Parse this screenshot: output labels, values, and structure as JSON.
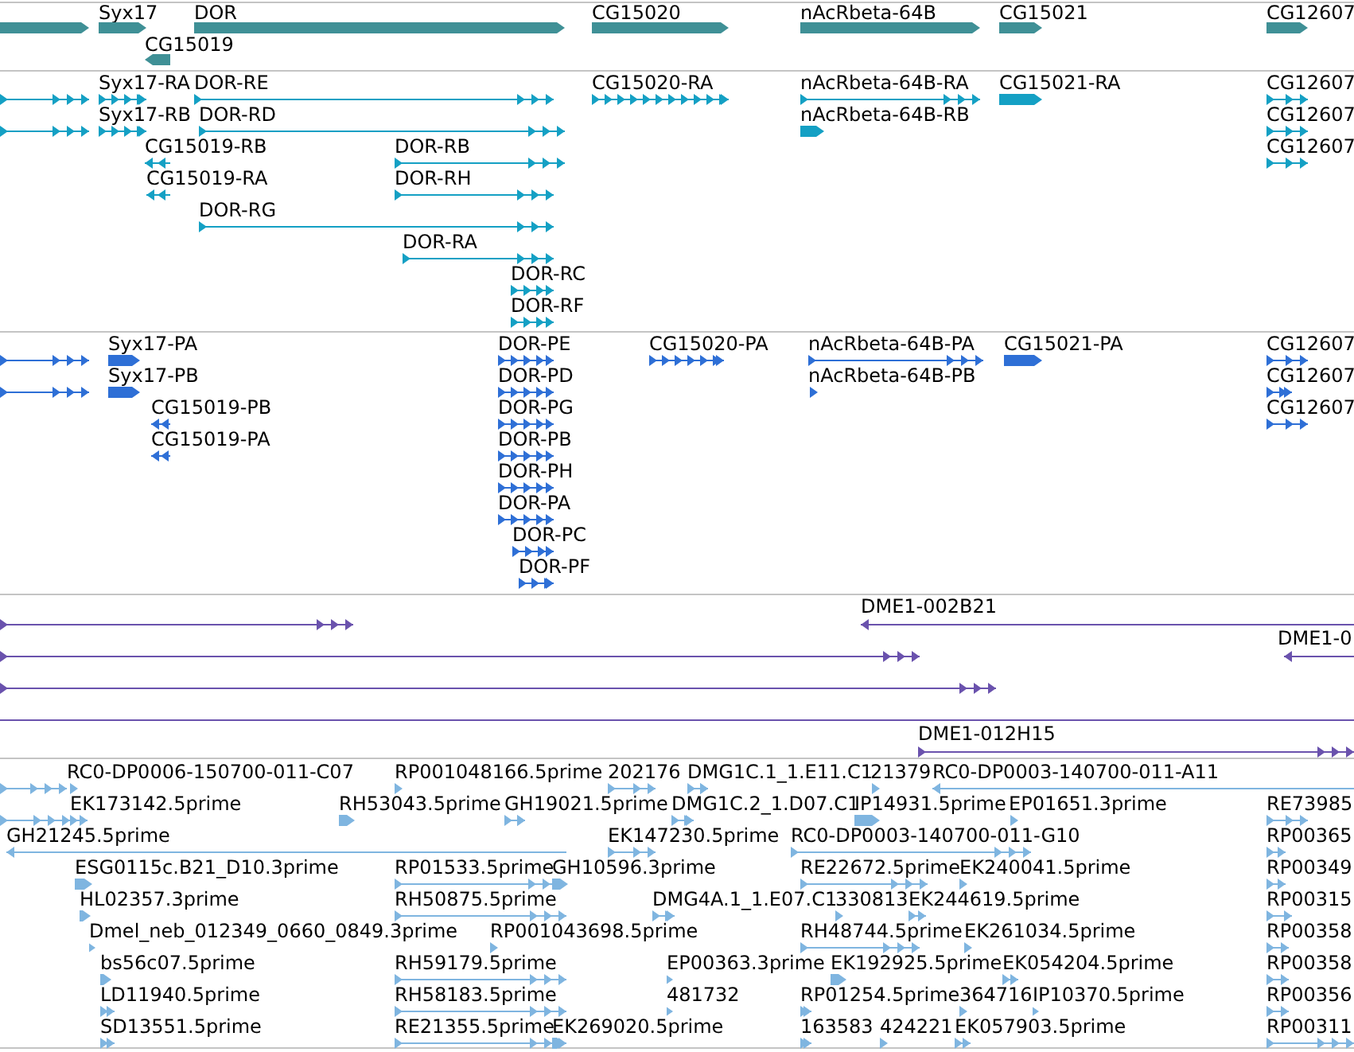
{
  "tracks": [
    {
      "kind": "gene",
      "features": [
        {
          "label": "Syx17"
        },
        {
          "label": "DOR"
        },
        {
          "label": "CG15020"
        },
        {
          "label": "nAcRbeta-64B"
        },
        {
          "label": "CG15021"
        },
        {
          "label": "CG12607"
        },
        {
          "label": "CG15019"
        }
      ]
    },
    {
      "kind": "transcript",
      "features": [
        {
          "label": "Syx17-RA"
        },
        {
          "label": "DOR-RE"
        },
        {
          "label": "CG15020-RA"
        },
        {
          "label": "nAcRbeta-64B-RA"
        },
        {
          "label": "CG15021-RA"
        },
        {
          "label": "CG12607"
        },
        {
          "label": "Syx17-RB"
        },
        {
          "label": "DOR-RD"
        },
        {
          "label": "nAcRbeta-64B-RB"
        },
        {
          "label": "CG12607"
        },
        {
          "label": "CG15019-RB"
        },
        {
          "label": "DOR-RB"
        },
        {
          "label": "CG12607"
        },
        {
          "label": "CG15019-RA"
        },
        {
          "label": "DOR-RH"
        },
        {
          "label": "DOR-RG"
        },
        {
          "label": "DOR-RA"
        },
        {
          "label": "DOR-RC"
        },
        {
          "label": "DOR-RF"
        }
      ]
    },
    {
      "kind": "protein",
      "features": [
        {
          "label": "Syx17-PA"
        },
        {
          "label": "DOR-PE"
        },
        {
          "label": "CG15020-PA"
        },
        {
          "label": "nAcRbeta-64B-PA"
        },
        {
          "label": "CG15021-PA"
        },
        {
          "label": "CG12607"
        },
        {
          "label": "Syx17-PB"
        },
        {
          "label": "DOR-PD"
        },
        {
          "label": "nAcRbeta-64B-PB"
        },
        {
          "label": "CG12607"
        },
        {
          "label": "CG15019-PB"
        },
        {
          "label": "DOR-PG"
        },
        {
          "label": "CG12607"
        },
        {
          "label": "CG15019-PA"
        },
        {
          "label": "DOR-PB"
        },
        {
          "label": "DOR-PH"
        },
        {
          "label": "DOR-PA"
        },
        {
          "label": "DOR-PC"
        },
        {
          "label": "DOR-PF"
        }
      ]
    },
    {
      "kind": "clone",
      "features": [
        {
          "label": "DME1-002B21"
        },
        {
          "label": "DME1-0"
        },
        {
          "label": "DME1-012H15"
        }
      ]
    },
    {
      "kind": "est",
      "features": [
        {
          "label": "RC0-DP0006-150700-011-C07"
        },
        {
          "label": "RP001048166.5prime"
        },
        {
          "label": "202176"
        },
        {
          "label": "DMG1C.1_1.E11.C1"
        },
        {
          "label": "21379"
        },
        {
          "label": "RC0-DP0003-140700-011-A11"
        },
        {
          "label": "EK173142.5prime"
        },
        {
          "label": "RH53043.5prime"
        },
        {
          "label": "GH19021.5prime"
        },
        {
          "label": "DMG1C.2_1.D07.C1"
        },
        {
          "label": "IP14931.5prime"
        },
        {
          "label": "EP01651.3prime"
        },
        {
          "label": "RE73985"
        },
        {
          "label": "GH21245.5prime"
        },
        {
          "label": "EK147230.5prime"
        },
        {
          "label": "RC0-DP0003-140700-011-G10"
        },
        {
          "label": "RP00365"
        },
        {
          "label": "ESG0115c.B21_D10.3prime"
        },
        {
          "label": "RP01533.5prime"
        },
        {
          "label": "GH10596.3prime"
        },
        {
          "label": "RE22672.5prime"
        },
        {
          "label": "EK240041.5prime"
        },
        {
          "label": "RP00349"
        },
        {
          "label": "HL02357.3prime"
        },
        {
          "label": "RH50875.5prime"
        },
        {
          "label": "DMG4A.1_1.E07.C1"
        },
        {
          "label": "330813"
        },
        {
          "label": "EK244619.5prime"
        },
        {
          "label": "RP00315"
        },
        {
          "label": "Dmel_neb_012349_0660_0849.3prime"
        },
        {
          "label": "RP001043698.5prime"
        },
        {
          "label": "RH48744.5prime"
        },
        {
          "label": "EK261034.5prime"
        },
        {
          "label": "RP00358"
        },
        {
          "label": "bs56c07.5prime"
        },
        {
          "label": "RH59179.5prime"
        },
        {
          "label": "EP00363.3prime"
        },
        {
          "label": "EK192925.5prime"
        },
        {
          "label": "EK054204.5prime"
        },
        {
          "label": "RP00358"
        },
        {
          "label": "LD11940.5prime"
        },
        {
          "label": "RH58183.5prime"
        },
        {
          "label": "481732"
        },
        {
          "label": "RP01254.5prime"
        },
        {
          "label": "364716"
        },
        {
          "label": "IP10370.5prime"
        },
        {
          "label": "RP00356"
        },
        {
          "label": "SD13551.5prime"
        },
        {
          "label": "RE21355.5prime"
        },
        {
          "label": "EK269020.5prime"
        },
        {
          "label": "163583"
        },
        {
          "label": "424221"
        },
        {
          "label": "EK057903.5prime"
        },
        {
          "label": "RP00311"
        }
      ]
    }
  ]
}
